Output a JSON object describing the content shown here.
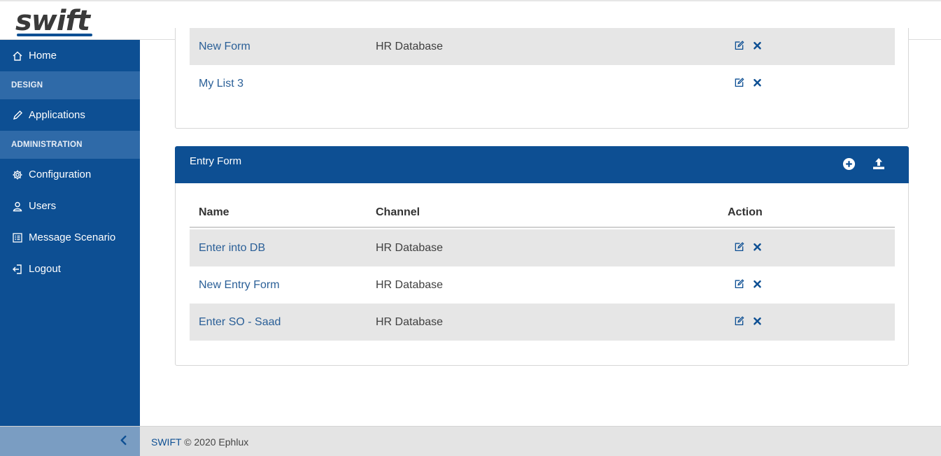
{
  "app": {
    "logo": "swift"
  },
  "sidebar": {
    "home": "Home",
    "section_design": "DESIGN",
    "applications": "Applications",
    "section_admin": "ADMINISTRATION",
    "configuration": "Configuration",
    "users": "Users",
    "message_scenario": "Message Scenario",
    "logout": "Logout"
  },
  "top_list": {
    "rows": [
      {
        "name": "New Form",
        "channel": "HR Database"
      },
      {
        "name": "My List 3",
        "channel": ""
      }
    ]
  },
  "entry_form": {
    "title": "Entry Form",
    "columns": {
      "name": "Name",
      "channel": "Channel",
      "action": "Action"
    },
    "rows": [
      {
        "name": "Enter into DB",
        "channel": "HR Database"
      },
      {
        "name": "New Entry Form",
        "channel": "HR Database"
      },
      {
        "name": "Enter SO - Saad",
        "channel": "HR Database"
      }
    ]
  },
  "footer": {
    "brand": "SWIFT",
    "text": "© 2020 Ephlux"
  },
  "colors": {
    "primary": "#0d4f93",
    "section": "#2f6aa8",
    "row_shade": "#e6e6e6",
    "link": "#2a5f97"
  },
  "icons": {
    "home": "home-icon",
    "applications": "pencil-icon",
    "configuration": "gear-icon",
    "users": "user-icon",
    "message_scenario": "list-icon",
    "logout": "logout-icon",
    "edit": "edit-icon",
    "delete": "close-icon",
    "add": "plus-circle-icon",
    "upload": "upload-icon",
    "collapse": "chevron-left-icon"
  }
}
